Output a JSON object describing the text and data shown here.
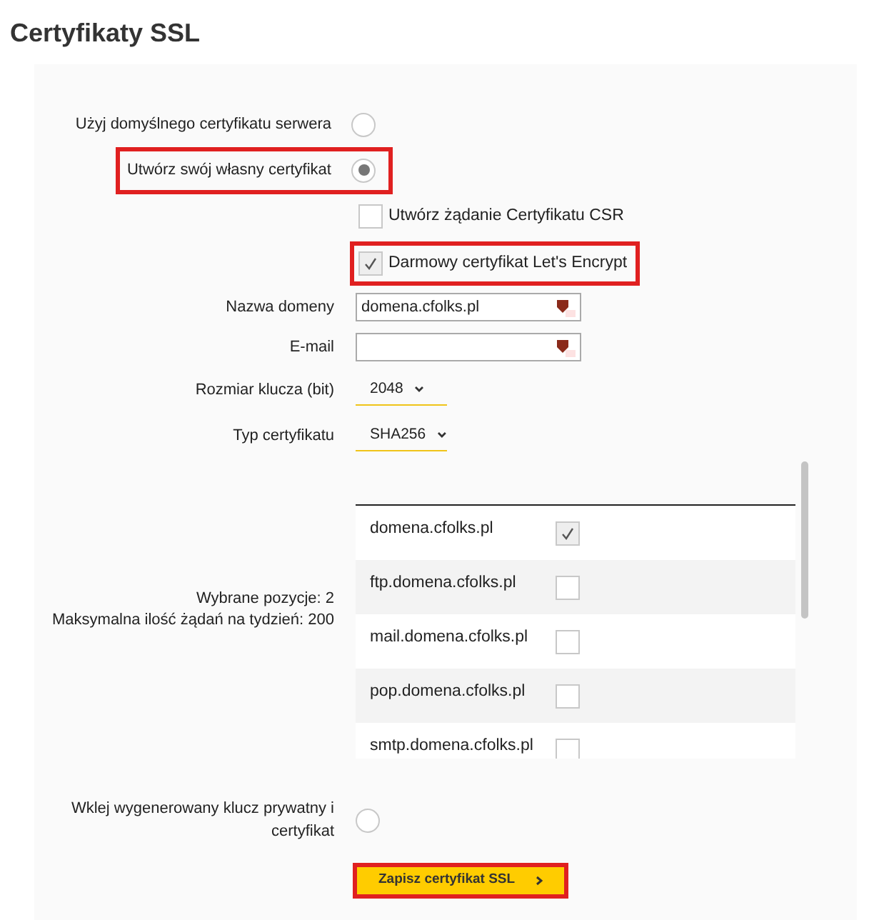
{
  "title": "Certyfikaty SSL",
  "modes": [
    {
      "label": "Użyj domyślnego certyfikatu serwera",
      "selected": false,
      "highlighted": false
    },
    {
      "label": "Utwórz swój własny certyfikat",
      "selected": true,
      "highlighted": true
    }
  ],
  "options": [
    {
      "label": "Utwórz żądanie Certyfikatu CSR",
      "checked": false,
      "highlighted": false
    },
    {
      "label": "Darmowy certyfikat Let's Encrypt",
      "checked": true,
      "highlighted": true
    }
  ],
  "fields": [
    {
      "kind": "text",
      "label": "Nazwa domeny",
      "value": "domena.cfolks.pl"
    },
    {
      "kind": "text",
      "label": "E-mail"
    },
    {
      "kind": "select",
      "label": "Rozmiar klucza (bit)",
      "value": "2048"
    },
    {
      "kind": "select",
      "label": "Typ certyfikatu",
      "value": "SHA256"
    }
  ],
  "domains": {
    "info": [
      "Wybrane pozycje: 2",
      "Maksymalna ilość żądań na tydzień: 200"
    ],
    "rows": [
      {
        "name": "domena.cfolks.pl",
        "checked": true
      },
      {
        "name": "ftp.domena.cfolks.pl",
        "checked": false
      },
      {
        "name": "mail.domena.cfolks.pl",
        "checked": false
      },
      {
        "name": "pop.domena.cfolks.pl",
        "checked": false
      },
      {
        "name": "smtp.domena.cfolks.pl",
        "checked": false
      }
    ]
  },
  "paste": {
    "label": "Wklej wygenerowany klucz prywatny i certyfikat",
    "selected": false
  },
  "save_button": {
    "label": "Zapisz certyfikat SSL",
    "highlighted": true
  }
}
